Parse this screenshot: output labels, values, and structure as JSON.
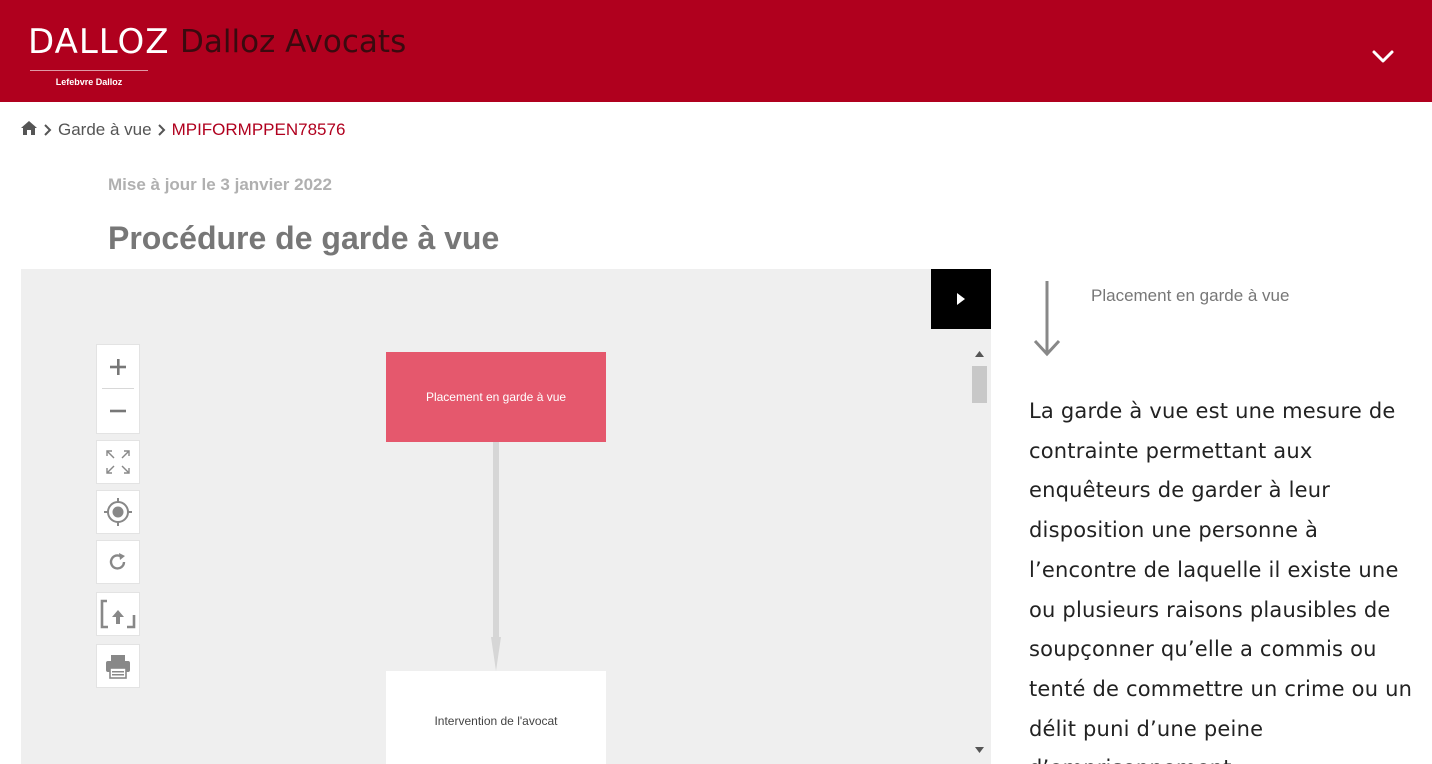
{
  "header": {
    "logo_text": "DALLOZ",
    "logo_subtitle": "Lefebvre Dalloz",
    "site_title": "Dalloz Avocats",
    "menu_icon": "chevron-down-icon"
  },
  "breadcrumb": {
    "home_icon": "home-icon",
    "items": [
      "Garde à vue",
      "MPIFORMPPEN78576"
    ]
  },
  "article": {
    "updated": "Mise à jour le 3 janvier 2022",
    "title": "Procédure de garde à vue"
  },
  "diagram": {
    "nodes": [
      "Placement en garde à vue",
      "Intervention de l'avocat"
    ],
    "toolbar": [
      "plus-icon",
      "minus-icon",
      "fit-screen-icon",
      "locate-icon",
      "refresh-icon",
      "export-icon",
      "print-icon"
    ],
    "colors": {
      "active_node": "#e5586d",
      "background": "#efefef",
      "connector": "#d6d6d6"
    }
  },
  "panel": {
    "step_title": "Placement en garde à vue",
    "description": "La garde à vue est une mesure de contrainte permettant aux enquêteurs de garder à leur disposition une personne à l’encontre de laquelle il existe une ou plusieurs raisons plausibles de soupçonner qu’elle a commis ou tenté de commettre un crime ou un délit puni d’une peine d’emprisonnement."
  },
  "colors": {
    "brand": "#b0001e",
    "breadcrumb_current": "#b0001e"
  }
}
